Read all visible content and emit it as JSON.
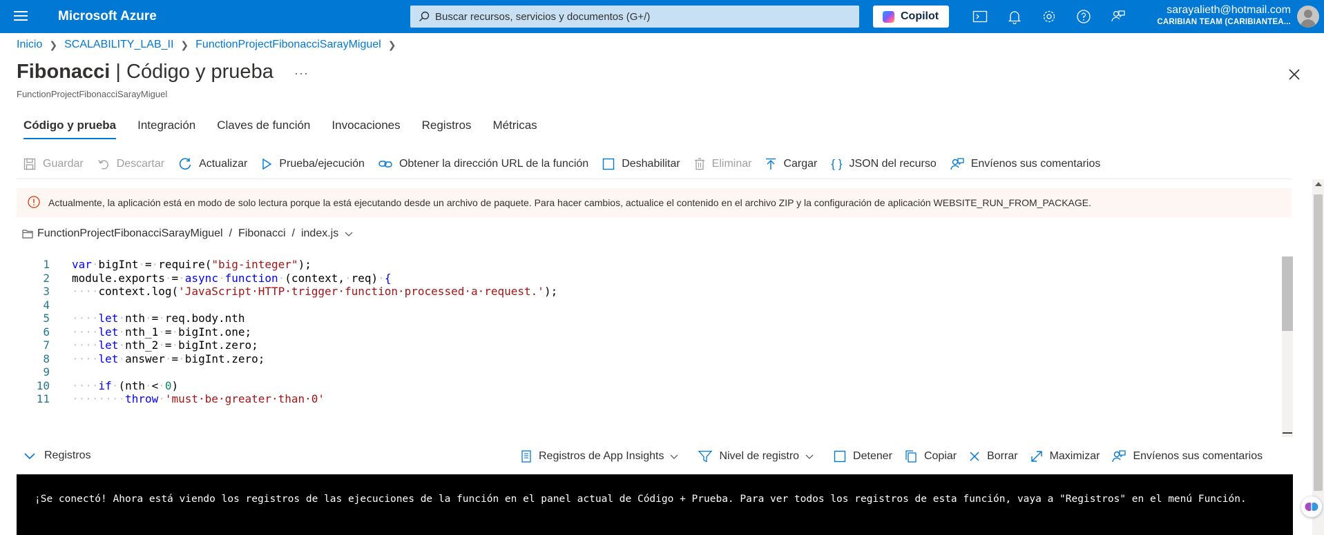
{
  "topbar": {
    "brand": "Microsoft Azure",
    "search_placeholder": "Buscar recursos, servicios y documentos (G+/)",
    "copilot_label": "Copilot",
    "icons": [
      "cloud-shell-icon",
      "bell-icon",
      "gear-icon",
      "help-icon",
      "feedback-icon"
    ],
    "user_email": "sarayalieth@hotmail.com",
    "user_team": "CARIBIAN TEAM (CARIBIANTEA..."
  },
  "breadcrumb": {
    "items": [
      "Inicio",
      "SCALABILITY_LAB_II",
      "FunctionProjectFibonacciSarayMiguel"
    ]
  },
  "header": {
    "title_bold": "Fibonacci",
    "title_rest": " | Código y prueba",
    "more": "···",
    "subtitle": "FunctionProjectFibonacciSarayMiguel"
  },
  "tabs": [
    "Código y prueba",
    "Integración",
    "Claves de función",
    "Invocaciones",
    "Registros",
    "Métricas"
  ],
  "toolbar": {
    "save": "Guardar",
    "discard": "Descartar",
    "refresh": "Actualizar",
    "test_run": "Prueba/ejecución",
    "get_url": "Obtener la dirección URL de la función",
    "disable": "Deshabilitar",
    "delete": "Eliminar",
    "upload": "Cargar",
    "json": "JSON del recurso",
    "feedback": "Envíenos sus comentarios"
  },
  "warning": {
    "text": "Actualmente, la aplicación está en modo de solo lectura porque la está ejecutando desde un archivo de paquete. Para hacer cambios, actualice el contenido en el archivo ZIP y la configuración de aplicación WEBSITE_RUN_FROM_PACKAGE."
  },
  "filepath": {
    "root": "FunctionProjectFibonacciSarayMiguel",
    "folder": "Fibonacci",
    "file": "index.js"
  },
  "editor": {
    "lines": [
      {
        "n": "1",
        "tokens": [
          [
            "kw",
            "var"
          ],
          [
            "ws",
            "·"
          ],
          [
            "t",
            "bigInt"
          ],
          [
            "ws",
            "·"
          ],
          [
            "t",
            "="
          ],
          [
            "ws",
            "·"
          ],
          [
            "t",
            "require("
          ],
          [
            "str",
            "\"big-integer\""
          ],
          [
            "t",
            ");"
          ]
        ]
      },
      {
        "n": "2",
        "tokens": [
          [
            "t",
            "module.exports"
          ],
          [
            "ws",
            "·"
          ],
          [
            "t",
            "="
          ],
          [
            "ws",
            "·"
          ],
          [
            "kw",
            "async"
          ],
          [
            "ws",
            "·"
          ],
          [
            "kw",
            "function"
          ],
          [
            "ws",
            "·"
          ],
          [
            "t",
            "(context,"
          ],
          [
            "ws",
            "·"
          ],
          [
            "t",
            "req)"
          ],
          [
            "ws",
            "·"
          ],
          [
            "kw",
            "{"
          ]
        ]
      },
      {
        "n": "3",
        "tokens": [
          [
            "ws",
            "····"
          ],
          [
            "t",
            "context.log("
          ],
          [
            "str",
            "'JavaScript·HTTP·trigger·function·processed·a·request.'"
          ],
          [
            "t",
            ");"
          ]
        ]
      },
      {
        "n": "4",
        "tokens": []
      },
      {
        "n": "5",
        "tokens": [
          [
            "ws",
            "····"
          ],
          [
            "kw",
            "let"
          ],
          [
            "ws",
            "·"
          ],
          [
            "t",
            "nth"
          ],
          [
            "ws",
            "·"
          ],
          [
            "t",
            "="
          ],
          [
            "ws",
            "·"
          ],
          [
            "t",
            "req.body.nth"
          ]
        ]
      },
      {
        "n": "6",
        "tokens": [
          [
            "ws",
            "····"
          ],
          [
            "kw",
            "let"
          ],
          [
            "ws",
            "·"
          ],
          [
            "t",
            "nth_1"
          ],
          [
            "ws",
            "·"
          ],
          [
            "t",
            "="
          ],
          [
            "ws",
            "·"
          ],
          [
            "t",
            "bigInt.one;"
          ]
        ]
      },
      {
        "n": "7",
        "tokens": [
          [
            "ws",
            "····"
          ],
          [
            "kw",
            "let"
          ],
          [
            "ws",
            "·"
          ],
          [
            "t",
            "nth_2"
          ],
          [
            "ws",
            "·"
          ],
          [
            "t",
            "="
          ],
          [
            "ws",
            "·"
          ],
          [
            "t",
            "bigInt.zero;"
          ]
        ]
      },
      {
        "n": "8",
        "tokens": [
          [
            "ws",
            "····"
          ],
          [
            "kw",
            "let"
          ],
          [
            "ws",
            "·"
          ],
          [
            "t",
            "answer"
          ],
          [
            "ws",
            "·"
          ],
          [
            "t",
            "="
          ],
          [
            "ws",
            "·"
          ],
          [
            "t",
            "bigInt.zero;"
          ]
        ]
      },
      {
        "n": "9",
        "tokens": []
      },
      {
        "n": "10",
        "tokens": [
          [
            "ws",
            "····"
          ],
          [
            "kw",
            "if"
          ],
          [
            "ws",
            "·"
          ],
          [
            "t",
            "(nth"
          ],
          [
            "ws",
            "·"
          ],
          [
            "t",
            "<"
          ],
          [
            "ws",
            "·"
          ],
          [
            "num",
            "0"
          ],
          [
            "t",
            ")"
          ]
        ]
      },
      {
        "n": "11",
        "tokens": [
          [
            "ws",
            "····"
          ],
          [
            "ws",
            "····"
          ],
          [
            "kw",
            "throw"
          ],
          [
            "ws",
            "·"
          ],
          [
            "str",
            "'must·be·greater·than·0'"
          ]
        ]
      }
    ]
  },
  "logs": {
    "label": "Registros",
    "app_insights": "Registros de App Insights",
    "log_level": "Nivel de registro",
    "stop": "Detener",
    "copy": "Copiar",
    "clear": "Borrar",
    "maximize": "Maximizar",
    "feedback": "Envíenos sus comentarios",
    "console_message": "¡Se conectó! Ahora está viendo los registros de las ejecuciones de la función en el panel actual de Código + Prueba. Para ver todos los registros de esta función, vaya a \"Registros\" en el menú Función."
  },
  "colors": {
    "accent": "#0078d4",
    "search_bg": "#c7e0f4",
    "warning_bg": "#fdf6f3",
    "warning_icon": "#d83b01"
  }
}
